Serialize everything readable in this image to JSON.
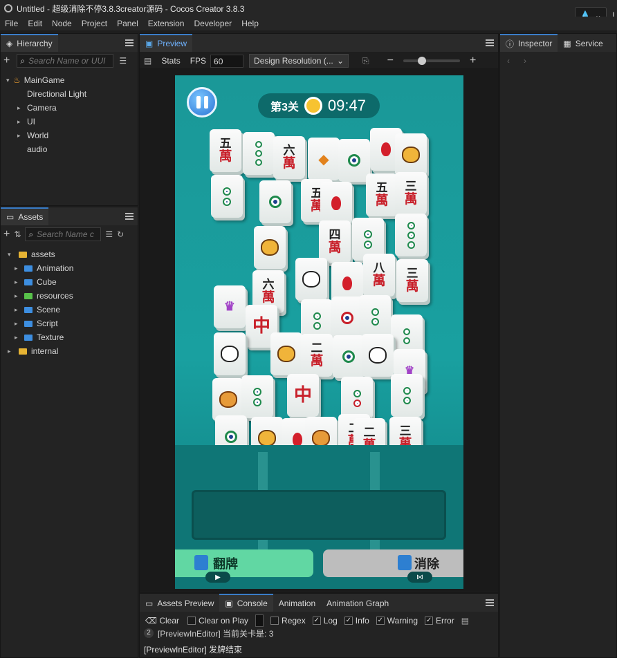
{
  "window": {
    "title": "Untitled - 超级消除不停3.8.3creator源码 - Cocos Creator 3.8.3",
    "right_label": "L"
  },
  "menu": [
    "File",
    "Edit",
    "Node",
    "Project",
    "Panel",
    "Extension",
    "Developer",
    "Help"
  ],
  "hierarchy": {
    "tab": "Hierarchy",
    "search_placeholder": "Search Name or UUI",
    "items": [
      {
        "label": "MainGame",
        "level": 0,
        "arrow": "▾"
      },
      {
        "label": "Directional Light",
        "level": 1,
        "arrow": ""
      },
      {
        "label": "Camera",
        "level": 1,
        "arrow": "▸"
      },
      {
        "label": "UI",
        "level": 1,
        "arrow": "▸"
      },
      {
        "label": "World",
        "level": 1,
        "arrow": "▸"
      },
      {
        "label": "audio",
        "level": 1,
        "arrow": ""
      }
    ]
  },
  "assets": {
    "tab": "Assets",
    "search_placeholder": "Search Name c",
    "items": [
      {
        "label": "assets",
        "level": 0,
        "arrow": "▾",
        "color": "gold"
      },
      {
        "label": "Animation",
        "level": 1,
        "arrow": "▸",
        "color": "blue"
      },
      {
        "label": "Cube",
        "level": 1,
        "arrow": "▸",
        "color": "blue"
      },
      {
        "label": "resources",
        "level": 1,
        "arrow": "▸",
        "color": "green"
      },
      {
        "label": "Scene",
        "level": 1,
        "arrow": "▸",
        "color": "blue"
      },
      {
        "label": "Script",
        "level": 1,
        "arrow": "▸",
        "color": "blue"
      },
      {
        "label": "Texture",
        "level": 1,
        "arrow": "▸",
        "color": "blue"
      },
      {
        "label": "internal",
        "level": 0,
        "arrow": "▸",
        "color": "gold"
      }
    ]
  },
  "preview": {
    "tab": "Preview",
    "stats": "Stats",
    "fps_label": "FPS",
    "fps_value": "60",
    "resolution": "Design Resolution (...",
    "zoom_fraction": 0.3
  },
  "inspector": {
    "tab": "Inspector",
    "service_tab": "Service"
  },
  "game": {
    "level": "第3关",
    "timer": "09:47",
    "flip_label": "翻牌",
    "clear_label": "消除"
  },
  "bottom": {
    "tabs": [
      "Assets Preview",
      "Console",
      "Animation",
      "Animation Graph"
    ],
    "clear": "Clear",
    "clear_on_play": "Clear on Play",
    "regex": "Regex",
    "filters": [
      "Log",
      "Info",
      "Warning",
      "Error"
    ],
    "logs": [
      {
        "count": "2",
        "text": "[PreviewInEditor] 当前关卡是: 3"
      },
      {
        "count": "",
        "text": "[PreviewInEditor] 发牌结束"
      }
    ]
  },
  "colors": {
    "accent": "#3a7dc9",
    "game_bg": "#1a9898",
    "flip_btn": "#61d7a3"
  }
}
